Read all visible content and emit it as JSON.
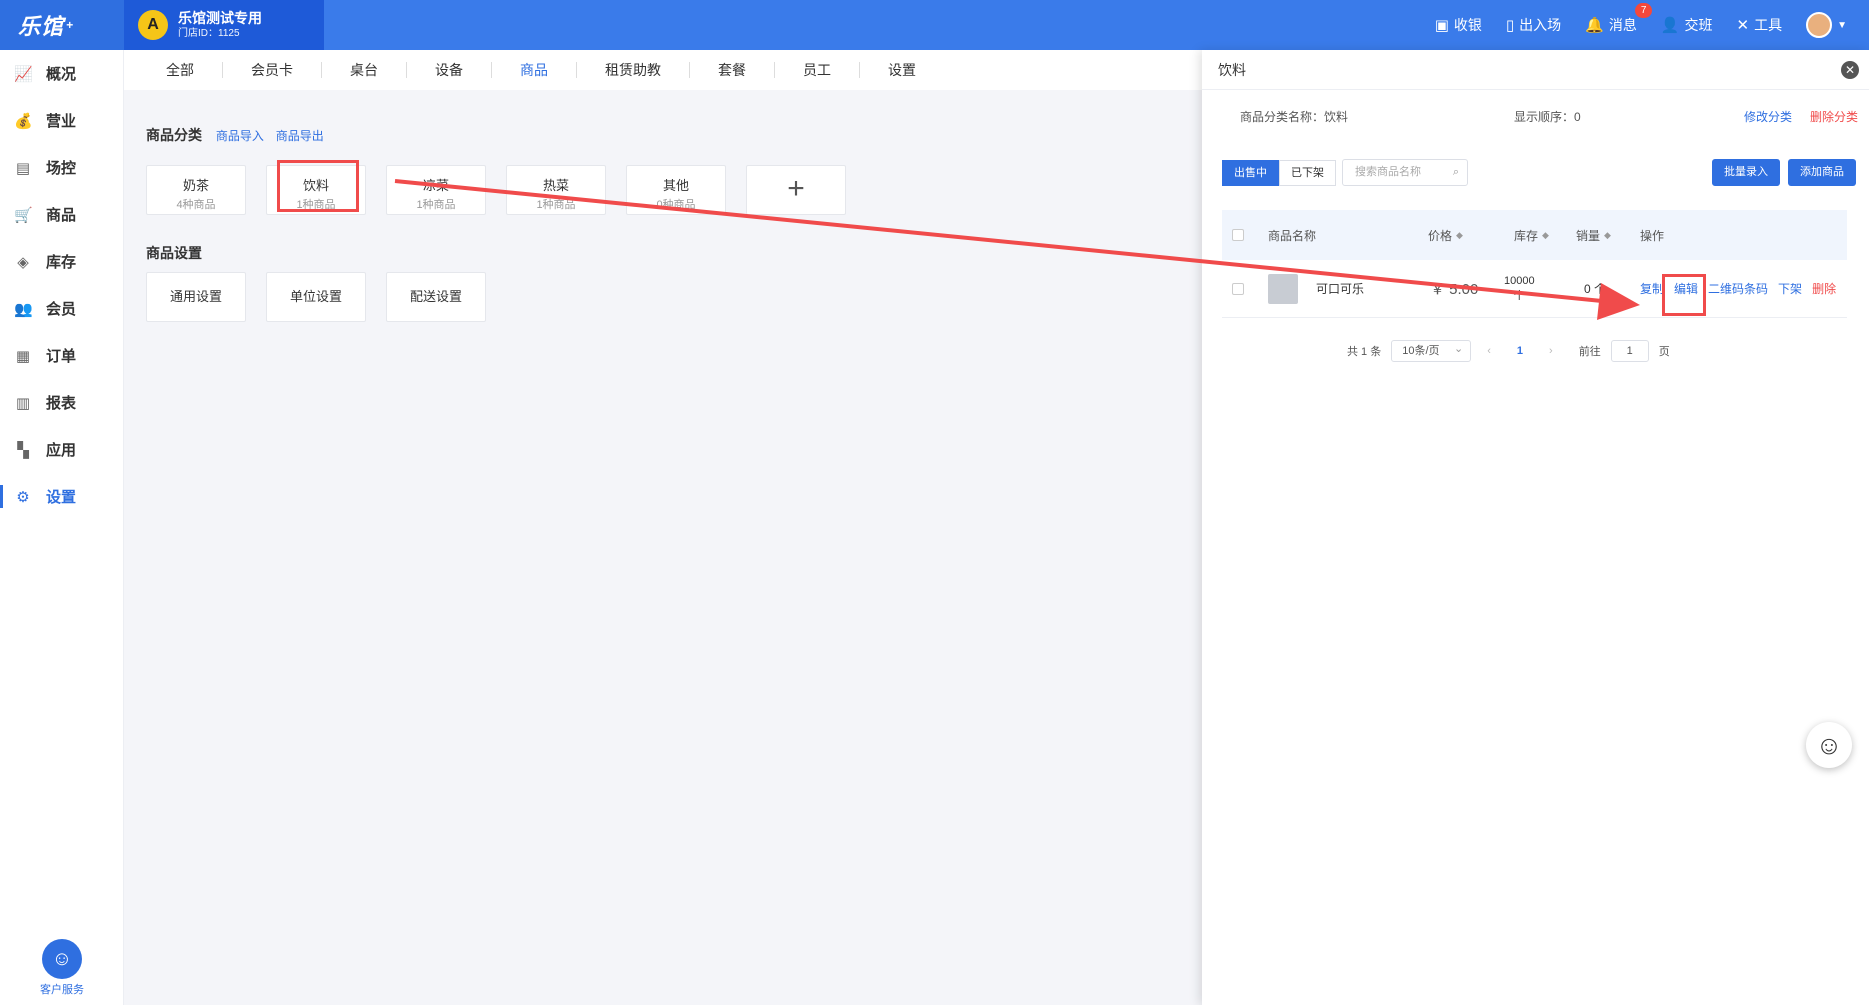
{
  "brand": {
    "name": "乐馆",
    "mark": "+"
  },
  "store": {
    "logo_letter": "A",
    "name": "乐馆测试专用",
    "id": "门店ID：1125"
  },
  "top_actions": [
    {
      "icon": "cash-register-icon",
      "label": "收银"
    },
    {
      "icon": "door-icon",
      "label": "出入场"
    },
    {
      "icon": "bell-icon",
      "label": "消息",
      "badge": "7"
    },
    {
      "icon": "user-switch-icon",
      "label": "交班"
    },
    {
      "icon": "tools-icon",
      "label": "工具"
    }
  ],
  "sidebar": {
    "items": [
      {
        "icon": "chart-icon",
        "label": "概况"
      },
      {
        "icon": "money-bag-icon",
        "label": "营业"
      },
      {
        "icon": "venue-icon",
        "label": "场控"
      },
      {
        "icon": "cart-icon",
        "label": "商品"
      },
      {
        "icon": "layers-icon",
        "label": "库存"
      },
      {
        "icon": "members-icon",
        "label": "会员"
      },
      {
        "icon": "order-icon",
        "label": "订单"
      },
      {
        "icon": "report-icon",
        "label": "报表"
      },
      {
        "icon": "apps-icon",
        "label": "应用"
      },
      {
        "icon": "gear-icon",
        "label": "设置",
        "active": true
      }
    ],
    "service_label": "客户服务"
  },
  "tabs": [
    {
      "label": "全部"
    },
    {
      "label": "会员卡"
    },
    {
      "label": "桌台"
    },
    {
      "label": "设备"
    },
    {
      "label": "商品",
      "active": true
    },
    {
      "label": "租赁助教"
    },
    {
      "label": "套餐"
    },
    {
      "label": "员工"
    },
    {
      "label": "设置"
    }
  ],
  "category_section": {
    "title": "商品分类",
    "import_link": "商品导入",
    "export_link": "商品导出",
    "categories": [
      {
        "name": "奶茶",
        "count": "4种商品"
      },
      {
        "name": "饮料",
        "count": "1种商品"
      },
      {
        "name": "凉菜",
        "count": "1种商品"
      },
      {
        "name": "热菜",
        "count": "1种商品"
      },
      {
        "name": "其他",
        "count": "0种商品"
      }
    ],
    "add_symbol": "+"
  },
  "settings_section": {
    "title": "商品设置",
    "items": [
      {
        "label": "通用设置"
      },
      {
        "label": "单位设置"
      },
      {
        "label": "配送设置"
      }
    ]
  },
  "panel": {
    "title": "饮料",
    "category_name": "商品分类名称：饮料",
    "display_order": "显示顺序：0",
    "edit_category": "修改分类",
    "delete_category": "删除分类",
    "status_tabs": [
      {
        "label": "出售中",
        "active": true
      },
      {
        "label": "已下架"
      }
    ],
    "search_placeholder": "搜索商品名称",
    "batch_button": "批量录入",
    "add_button": "添加商品",
    "columns": {
      "name": "商品名称",
      "price": "价格",
      "stock": "库存",
      "sales": "销量",
      "ops": "操作"
    },
    "rows": [
      {
        "name": "可口可乐",
        "price": "￥ 5.00",
        "stock_value": "10000",
        "stock_unit": "个",
        "sales": "0 个",
        "ops": {
          "copy": "复制",
          "edit": "编辑",
          "qrcode": "二维码条码",
          "off_shelf": "下架",
          "delete": "删除"
        }
      }
    ],
    "pagination": {
      "total": "共 1 条",
      "page_size": "10条/页",
      "current": "1",
      "goto_label": "前往",
      "goto_value": "1",
      "page_unit": "页"
    }
  },
  "colors": {
    "primary": "#2f6fe0",
    "danger": "#f04b4b",
    "topbar": "#3a7bea"
  }
}
